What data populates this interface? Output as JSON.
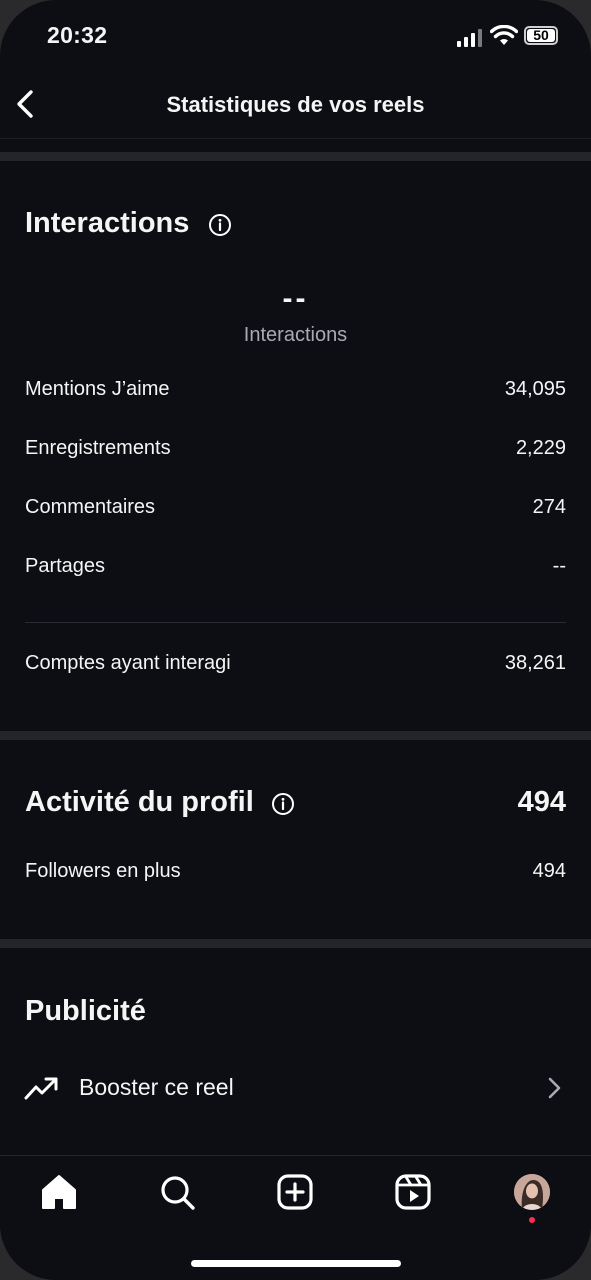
{
  "status_bar": {
    "time": "20:32",
    "battery": "50"
  },
  "header": {
    "title": "Statistiques de vos reels"
  },
  "interactions": {
    "title": "Interactions",
    "total_value": "--",
    "total_label": "Interactions",
    "rows": [
      {
        "label": "Mentions J’aime",
        "value": "34,095"
      },
      {
        "label": "Enregistrements",
        "value": "2,229"
      },
      {
        "label": "Commentaires",
        "value": "274"
      },
      {
        "label": "Partages",
        "value": "--"
      }
    ],
    "accounts": {
      "label": "Comptes ayant interagi",
      "value": "38,261"
    }
  },
  "profile_activity": {
    "title": "Activité du profil",
    "total": "494",
    "rows": [
      {
        "label": "Followers en plus",
        "value": "494"
      }
    ]
  },
  "ads": {
    "title": "Publicité",
    "boost_label": "Booster ce reel"
  },
  "icons": {
    "back": "chevron-left-icon",
    "info": "info-icon",
    "boost": "trending-up-icon",
    "chevron": "chevron-right-icon",
    "tabs": [
      "home-icon",
      "search-icon",
      "plus-square-icon",
      "reels-icon",
      "avatar"
    ]
  },
  "colors": {
    "background": "#0c0e13",
    "separator": "#23252b",
    "secondary_text": "#a8abb3",
    "notification_dot": "#ff2d55"
  }
}
